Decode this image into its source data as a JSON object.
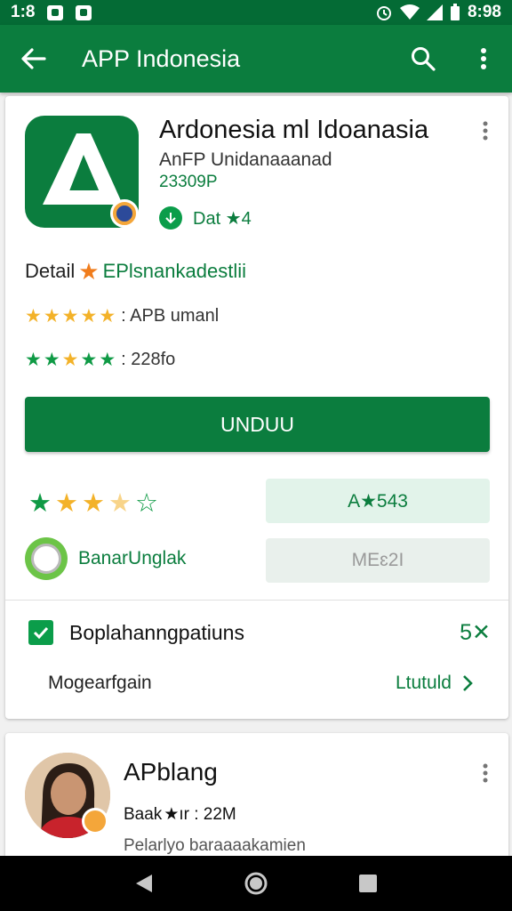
{
  "status_bar": {
    "time": "1:8",
    "clock": "8:98"
  },
  "app_bar": {
    "title": "APP Indonesia"
  },
  "app": {
    "name": "Ardonesia ml Idoanasia",
    "developer": "AnFP Unidanaaanad",
    "size": "23309P",
    "installed_label": "Dat ★4",
    "detail_prefix": "Detail",
    "detail_text": "EPlsnankadestlii",
    "rating_line_1": ": APB umanl",
    "rating_line_2": ": 228fo",
    "install_button": "UNDUU",
    "stat_pill_1": "A★543",
    "badge_label": "BanarUnglak",
    "stat_pill_2": "MEɛ2I"
  },
  "permissions": {
    "label": "Boplahanngpatiuns",
    "close_label": "5✕",
    "manage_label": "Mogearfgain",
    "manage_link": "Ltutuld"
  },
  "second_card": {
    "name": "APblang",
    "meta_prefix": "Baak",
    "meta_suffix": "★ır : 22M",
    "description": "Pelarlyo baraaaakamien"
  },
  "colors": {
    "primary": "#0b7d3e",
    "accent_star": "#f3b229",
    "status_bar": "#046b35"
  }
}
